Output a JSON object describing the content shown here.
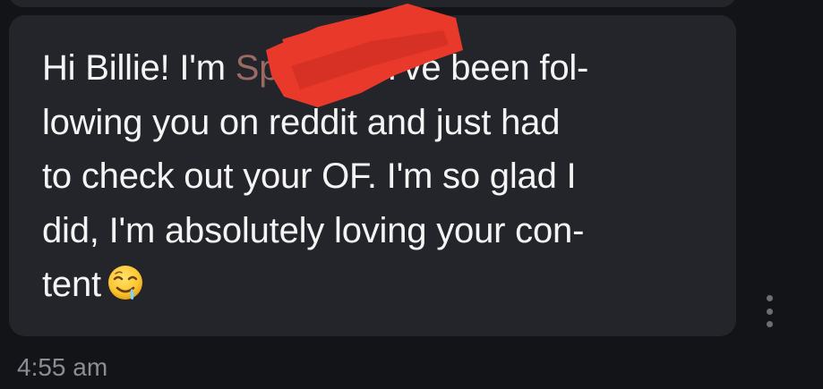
{
  "message": {
    "lines": [
      {
        "before": "Hi Billie! I'm ",
        "redacted": "Spencer!",
        "after": " I've been fol-"
      },
      {
        "text": "lowing you on reddit and just had"
      },
      {
        "text": "to check out your OF. I'm so glad I"
      },
      {
        "text": "did, I'm absolutely loving your con-"
      },
      {
        "text": "tent"
      }
    ],
    "emoji": "drooling-face-emoji",
    "time": "4:55 am"
  },
  "redaction": {
    "color": "#e8392b",
    "shape": "scribble"
  },
  "more_menu": {
    "icon": "more-vert-icon"
  },
  "colors": {
    "background": "#131417",
    "bubble": "#23252a",
    "text": "#f4f4f5",
    "timestamp": "#8a8d93",
    "dots": "#6b6e75"
  }
}
